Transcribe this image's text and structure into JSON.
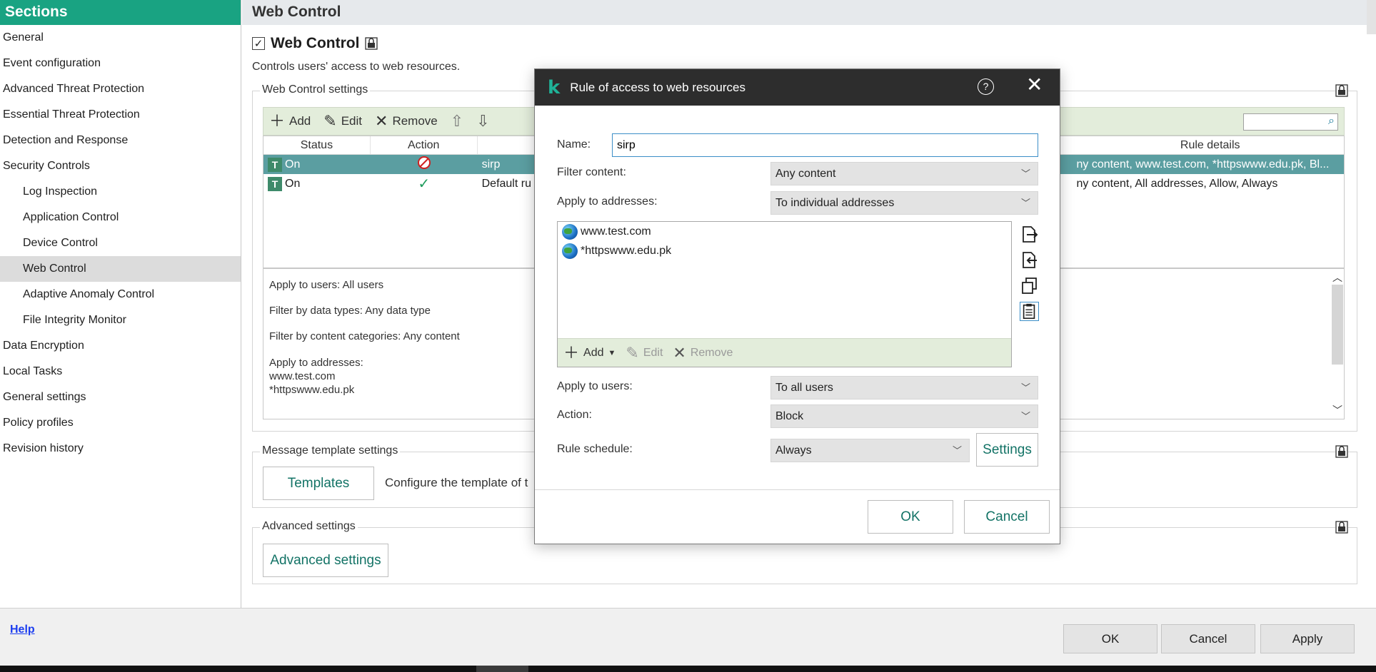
{
  "sidebar": {
    "header": "Sections",
    "items": [
      {
        "label": "General"
      },
      {
        "label": "Event configuration"
      },
      {
        "label": "Advanced Threat Protection"
      },
      {
        "label": "Essential Threat Protection"
      },
      {
        "label": "Detection and Response"
      },
      {
        "label": "Security Controls"
      },
      {
        "label": "Log Inspection"
      },
      {
        "label": "Application Control"
      },
      {
        "label": "Device Control"
      },
      {
        "label": "Web Control"
      },
      {
        "label": "Adaptive Anomaly Control"
      },
      {
        "label": "File Integrity Monitor"
      },
      {
        "label": "Data Encryption"
      },
      {
        "label": "Local Tasks"
      },
      {
        "label": "General settings"
      },
      {
        "label": "Policy profiles"
      },
      {
        "label": "Revision history"
      }
    ]
  },
  "main": {
    "header": "Web Control",
    "title": "Web Control",
    "description": "Controls users' access to web resources.",
    "settings_group": "Web Control settings",
    "toolbar": {
      "add": "Add",
      "edit": "Edit",
      "remove": "Remove"
    },
    "table": {
      "columns": [
        "Status",
        "Action",
        "Rule details"
      ],
      "rows": [
        {
          "status": "On",
          "name": "sirp",
          "details": "ny content, www.test.com, *httpswww.edu.pk, Bl..."
        },
        {
          "status": "On",
          "name": "Default ru",
          "details": "ny content, All addresses, Allow, Always"
        }
      ]
    },
    "details": {
      "users": "Apply to users: All users",
      "data_types": "Filter by data types: Any data type",
      "categories": "Filter by content categories: Any content",
      "addresses_label": "Apply to addresses:",
      "addresses": [
        "www.test.com",
        "*httpswww.edu.pk"
      ]
    },
    "message_group": "Message template settings",
    "templates_button": "Templates",
    "templates_text": "Configure the template of t",
    "advanced_group": "Advanced settings",
    "advanced_button": "Advanced settings"
  },
  "bottom": {
    "help": "Help",
    "ok": "OK",
    "cancel": "Cancel",
    "apply": "Apply"
  },
  "dialog": {
    "title": "Rule of access to web resources",
    "name_label": "Name:",
    "name_value": "sirp",
    "filter_label": "Filter content:",
    "filter_value": "Any content",
    "addr_label": "Apply to addresses:",
    "addr_value": "To individual addresses",
    "addresses": [
      "www.test.com",
      "*httpswww.edu.pk"
    ],
    "addr_toolbar": {
      "add": "Add",
      "edit": "Edit",
      "remove": "Remove"
    },
    "users_label": "Apply to users:",
    "users_value": "To all users",
    "action_label": "Action:",
    "action_value": "Block",
    "schedule_label": "Rule schedule:",
    "schedule_value": "Always",
    "settings_button": "Settings",
    "ok": "OK",
    "cancel": "Cancel"
  }
}
